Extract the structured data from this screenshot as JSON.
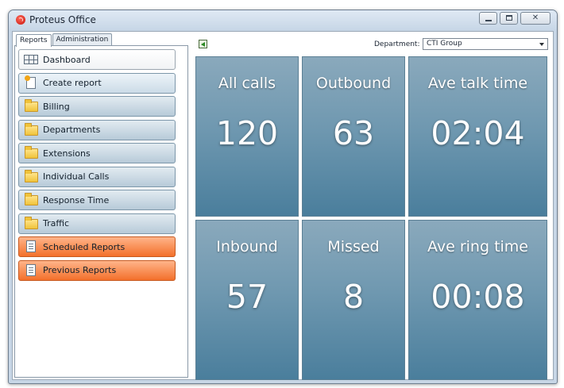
{
  "window": {
    "title": "Proteus Office"
  },
  "tabs": [
    {
      "label": "Reports",
      "active": true
    },
    {
      "label": "Administration",
      "active": false
    }
  ],
  "nav": [
    {
      "label": "Dashboard",
      "icon": "grid-icon",
      "style": "white"
    },
    {
      "label": "Create report",
      "icon": "new-report-icon",
      "style": "light"
    },
    {
      "label": "Billing",
      "icon": "folder-icon",
      "style": "blue"
    },
    {
      "label": "Departments",
      "icon": "folder-icon",
      "style": "blue"
    },
    {
      "label": "Extensions",
      "icon": "folder-icon",
      "style": "blue"
    },
    {
      "label": "Individual Calls",
      "icon": "folder-icon",
      "style": "blue"
    },
    {
      "label": "Response Time",
      "icon": "folder-icon",
      "style": "blue"
    },
    {
      "label": "Traffic",
      "icon": "folder-icon",
      "style": "blue"
    },
    {
      "label": "Scheduled Reports",
      "icon": "document-icon",
      "style": "orange"
    },
    {
      "label": "Previous Reports",
      "icon": "document-icon",
      "style": "orange"
    }
  ],
  "toolbar": {
    "department_label": "Department:",
    "department_value": "CTI Group"
  },
  "stats": [
    {
      "label": "All calls",
      "value": "120"
    },
    {
      "label": "Outbound",
      "value": "63"
    },
    {
      "label": "Ave talk time",
      "value": "02:04"
    },
    {
      "label": "Inbound",
      "value": "57"
    },
    {
      "label": "Missed",
      "value": "8"
    },
    {
      "label": "Ave ring time",
      "value": "00:08"
    }
  ],
  "colors": {
    "tile_top": "#8aa9bc",
    "tile_bottom": "#4a7e9c",
    "nav_blue": "#b7cad8",
    "nav_orange": "#f3702b",
    "window_frame": "#c7d6e6"
  }
}
